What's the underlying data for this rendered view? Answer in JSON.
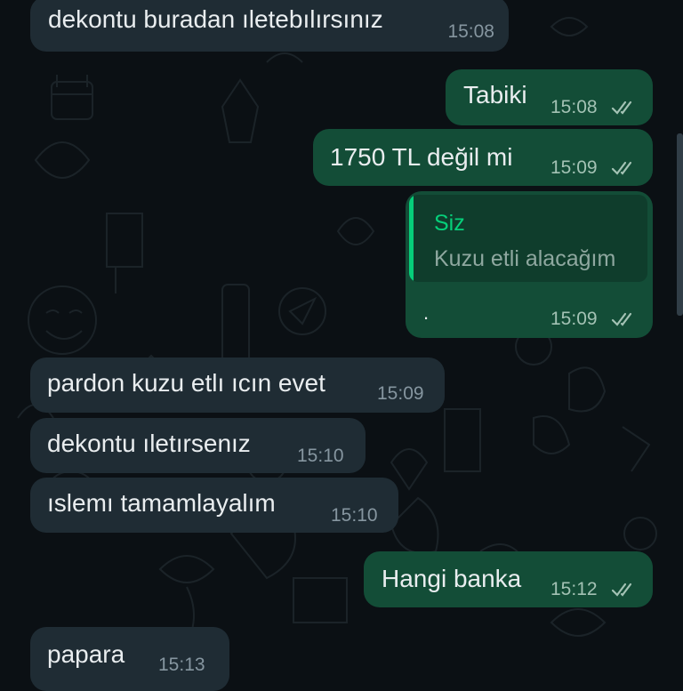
{
  "colors": {
    "background": "#0b1014",
    "incoming_bubble": "#1f2c34",
    "outgoing_bubble": "#134d37",
    "quote_accent": "#06cf7a",
    "text": "#e9edef",
    "timestamp": "#8696a0"
  },
  "messages": [
    {
      "direction": "incoming",
      "text": "dekontu buradan ıletebılırsınız",
      "time": "15:08"
    },
    {
      "direction": "outgoing",
      "text": "Tabiki",
      "time": "15:08",
      "status": "read"
    },
    {
      "direction": "outgoing",
      "text": "1750 TL değil mi",
      "time": "15:09",
      "status": "read"
    },
    {
      "direction": "outgoing",
      "quoted_sender": "Siz",
      "quoted_text": "Kuzu etli alacağım",
      "text": ".",
      "time": "15:09",
      "status": "read"
    },
    {
      "direction": "incoming",
      "text": "pardon kuzu etlı ıcın evet",
      "time": "15:09"
    },
    {
      "direction": "incoming",
      "text": "dekontu ıletırsenız",
      "time": "15:10"
    },
    {
      "direction": "incoming",
      "text": "ıslemı tamamlayalım",
      "time": "15:10"
    },
    {
      "direction": "outgoing",
      "text": "Hangi banka",
      "time": "15:12",
      "status": "read"
    },
    {
      "direction": "incoming",
      "text": "papara",
      "time": "15:13"
    }
  ]
}
